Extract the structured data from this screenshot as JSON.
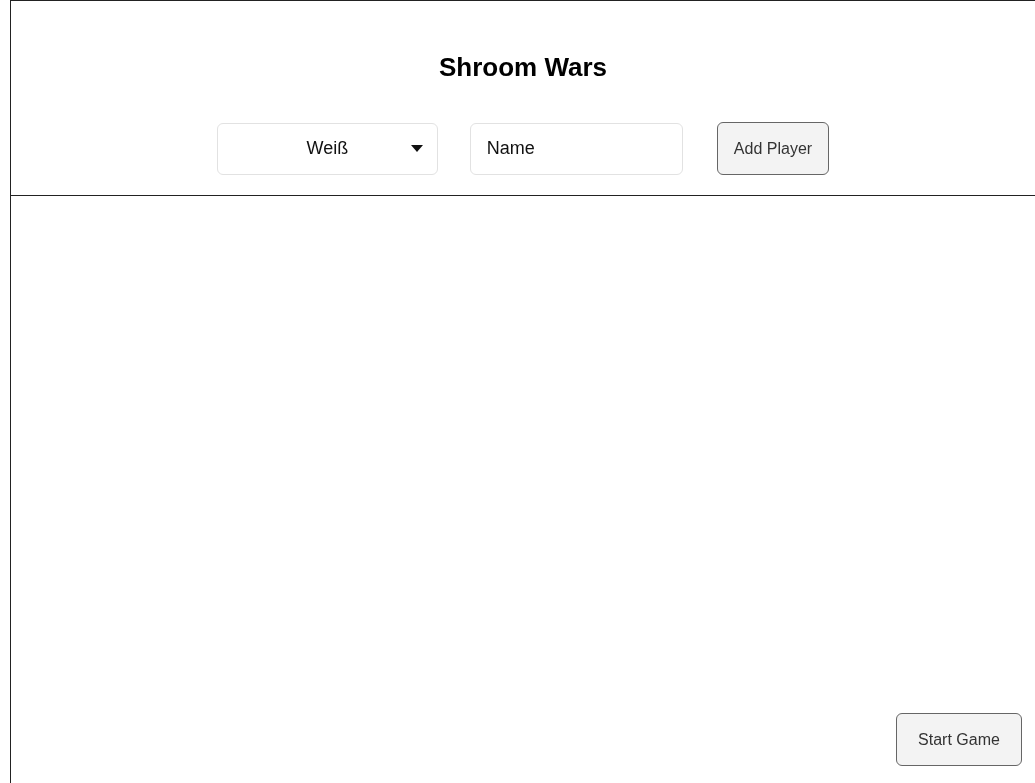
{
  "title": "Shroom Wars",
  "player_form": {
    "color_select": {
      "value": "Weiß"
    },
    "name_field": {
      "value": "Name"
    },
    "add_button": "Add Player"
  },
  "start_button": "Start Game"
}
